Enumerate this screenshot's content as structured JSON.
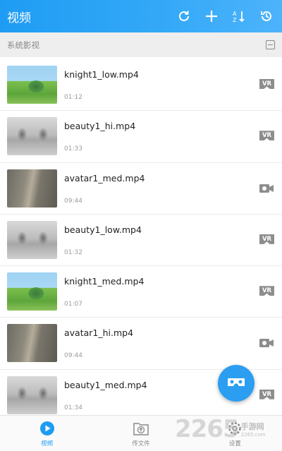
{
  "header": {
    "title": "视频",
    "icons": [
      "refresh-icon",
      "add-icon",
      "sort-icon",
      "history-icon"
    ]
  },
  "section": {
    "label": "系统影视"
  },
  "videos": [
    {
      "name": "knight1_low.mp4",
      "duration": "01:12",
      "thumb": "knight",
      "badge": "VR"
    },
    {
      "name": "beauty1_hi.mp4",
      "duration": "01:33",
      "thumb": "beauty",
      "badge": "VR"
    },
    {
      "name": "avatar1_med.mp4",
      "duration": "09:44",
      "thumb": "avatar",
      "badge": "camera"
    },
    {
      "name": "beauty1_low.mp4",
      "duration": "01:32",
      "thumb": "beauty",
      "badge": "VR"
    },
    {
      "name": "knight1_med.mp4",
      "duration": "01:07",
      "thumb": "knight",
      "badge": "VR"
    },
    {
      "name": "avatar1_hi.mp4",
      "duration": "09:44",
      "thumb": "avatar",
      "badge": "camera"
    },
    {
      "name": "beauty1_med.mp4",
      "duration": "01:34",
      "thumb": "beauty",
      "badge": "VR"
    }
  ],
  "nav": [
    {
      "label": "视频",
      "icon": "play-circle-icon",
      "active": true
    },
    {
      "label": "传文件",
      "icon": "upload-folder-icon",
      "active": false
    },
    {
      "label": "设置",
      "icon": "settings-icon",
      "active": false
    }
  ],
  "watermark": {
    "number": "2265",
    "cn": "手游网",
    "url": "2265.com"
  },
  "colors": {
    "accent": "#1e9cf3",
    "header_end": "#4db3fb",
    "badge_gray": "#8d8d8d"
  }
}
